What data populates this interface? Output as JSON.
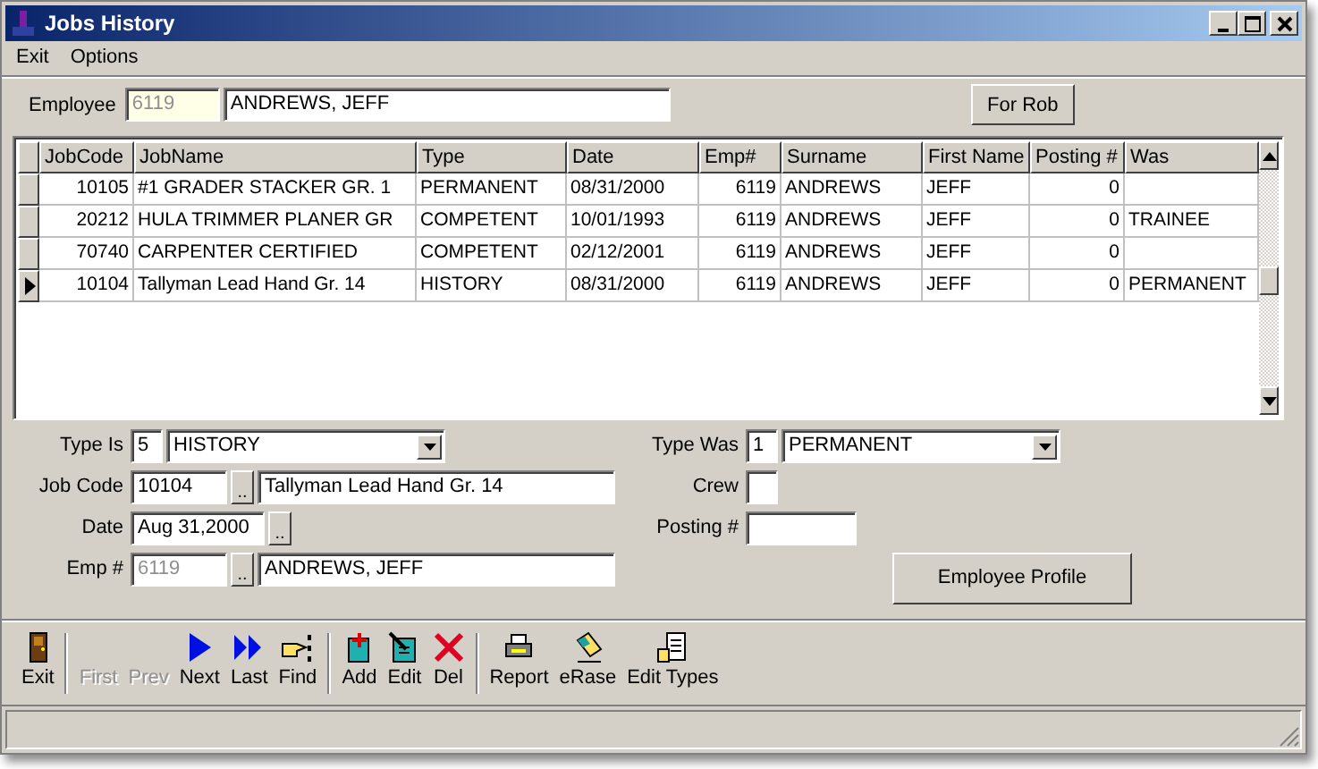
{
  "window": {
    "title": "Jobs History"
  },
  "menu": [
    "Exit",
    "Options"
  ],
  "employee": {
    "label": "Employee",
    "code": "6119",
    "code_disabled": true,
    "name": "ANDREWS, JEFF"
  },
  "for_rob_button": "For Rob",
  "table": {
    "columns": [
      "JobCode",
      "JobName",
      "Type",
      "Date",
      "Emp#",
      "Surname",
      "First Name",
      "Posting #",
      "Was"
    ],
    "rows": [
      {
        "selected": false,
        "cells": [
          "10105",
          "#1 GRADER STACKER GR. 1",
          "PERMANENT",
          "08/31/2000",
          "6119",
          "ANDREWS",
          "JEFF",
          "0",
          ""
        ]
      },
      {
        "selected": false,
        "cells": [
          "20212",
          "HULA TRIMMER PLANER GR",
          "COMPETENT",
          "10/01/1993",
          "6119",
          "ANDREWS",
          "JEFF",
          "0",
          "TRAINEE"
        ]
      },
      {
        "selected": false,
        "cells": [
          "70740",
          "CARPENTER CERTIFIED",
          "COMPETENT",
          "02/12/2001",
          "6119",
          "ANDREWS",
          "JEFF",
          "0",
          ""
        ]
      },
      {
        "selected": true,
        "cells": [
          "10104",
          "Tallyman Lead Hand Gr. 14",
          "HISTORY",
          "08/31/2000",
          "6119",
          "ANDREWS",
          "JEFF",
          "0",
          "PERMANENT"
        ]
      }
    ]
  },
  "form": {
    "type_is": {
      "label": "Type Is",
      "code": "5",
      "value": "HISTORY"
    },
    "job_code": {
      "label": "Job Code",
      "code": "10104",
      "name": "Tallyman Lead Hand Gr. 14",
      "button": ".."
    },
    "date": {
      "label": "Date",
      "value": "Aug 31,2000",
      "button": ".."
    },
    "emp": {
      "label": "Emp #",
      "code": "6119",
      "code_disabled": true,
      "name": "ANDREWS, JEFF",
      "button": ".."
    },
    "type_was": {
      "label": "Type Was",
      "code": "1",
      "value": "PERMANENT"
    },
    "crew": {
      "label": "Crew"
    },
    "posting": {
      "label": "Posting #"
    },
    "profile_button": "Employee Profile"
  },
  "toolbar": [
    [
      {
        "label": "Exit",
        "disabled": false
      }
    ],
    [
      {
        "label": "First",
        "disabled": true
      },
      {
        "label": "Prev",
        "disabled": true
      },
      {
        "label": "Next",
        "disabled": false
      },
      {
        "label": "Last",
        "disabled": false
      },
      {
        "label": "Find",
        "disabled": false
      }
    ],
    [
      {
        "label": "Add",
        "disabled": false
      },
      {
        "label": "Edit",
        "disabled": false
      },
      {
        "label": "Del",
        "disabled": false
      }
    ],
    [
      {
        "label": "Report",
        "disabled": false
      },
      {
        "label": "eRase",
        "disabled": false
      },
      {
        "label": "Edit Types",
        "disabled": false
      }
    ]
  ]
}
